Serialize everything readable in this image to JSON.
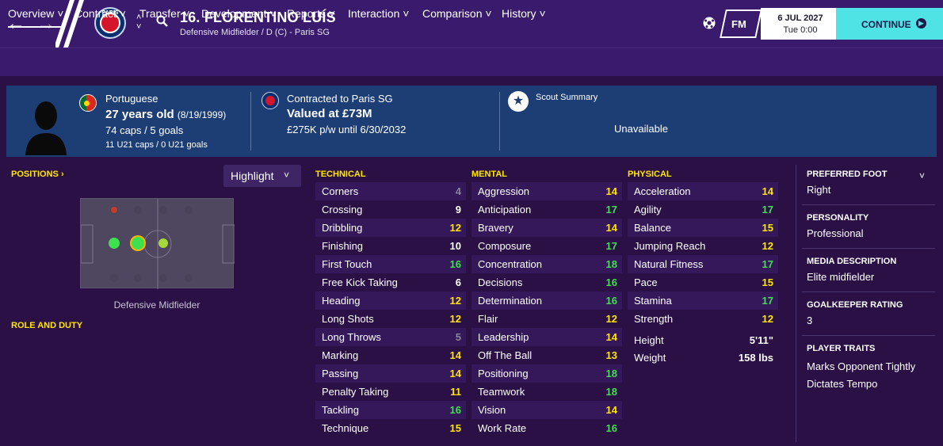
{
  "header": {
    "player_name": "16. FLORENTINO LUÍS",
    "player_subtitle": "Defensive Midfielder / D (C) - Paris SG",
    "club_badge_text": "PARIS",
    "fm_label": "FM",
    "date": "6 JUL 2027",
    "time": "Tue 0:00",
    "continue_label": "CONTINUE"
  },
  "tabs": [
    {
      "label": "Overview"
    },
    {
      "label": "Contract"
    },
    {
      "label": "Transfer"
    },
    {
      "label": "Development"
    },
    {
      "label": "Reports"
    },
    {
      "label": "Interaction"
    },
    {
      "label": "Comparison"
    },
    {
      "label": "History"
    }
  ],
  "info": {
    "nationality": "Portuguese",
    "age_label": "27 years old",
    "dob": "(8/19/1999)",
    "caps": "74 caps / 5 goals",
    "u21_caps": "11 U21 caps / 0 U21 goals",
    "contracted_to": "Contracted to Paris SG",
    "value": "Valued at £73M",
    "wage": "£275K p/w until 6/30/2032",
    "scout_title": "Scout Summary",
    "scout_status": "Unavailable"
  },
  "positions": {
    "title": "POSITIONS",
    "highlight_label": "Highlight",
    "position_label": "Defensive Midfielder",
    "role_duty_title": "ROLE AND DUTY"
  },
  "attributes": {
    "technical_title": "TECHNICAL",
    "mental_title": "MENTAL",
    "physical_title": "PHYSICAL",
    "technical": [
      {
        "name": "Corners",
        "value": "4",
        "tier": "gray"
      },
      {
        "name": "Crossing",
        "value": "9",
        "tier": "white"
      },
      {
        "name": "Dribbling",
        "value": "12",
        "tier": "yellow"
      },
      {
        "name": "Finishing",
        "value": "10",
        "tier": "white"
      },
      {
        "name": "First Touch",
        "value": "16",
        "tier": "green"
      },
      {
        "name": "Free Kick Taking",
        "value": "6",
        "tier": "white"
      },
      {
        "name": "Heading",
        "value": "12",
        "tier": "yellow"
      },
      {
        "name": "Long Shots",
        "value": "12",
        "tier": "yellow"
      },
      {
        "name": "Long Throws",
        "value": "5",
        "tier": "gray"
      },
      {
        "name": "Marking",
        "value": "14",
        "tier": "yellow"
      },
      {
        "name": "Passing",
        "value": "14",
        "tier": "yellow"
      },
      {
        "name": "Penalty Taking",
        "value": "11",
        "tier": "yellow"
      },
      {
        "name": "Tackling",
        "value": "16",
        "tier": "green"
      },
      {
        "name": "Technique",
        "value": "15",
        "tier": "yellow"
      }
    ],
    "mental": [
      {
        "name": "Aggression",
        "value": "14",
        "tier": "yellow"
      },
      {
        "name": "Anticipation",
        "value": "17",
        "tier": "green"
      },
      {
        "name": "Bravery",
        "value": "14",
        "tier": "yellow"
      },
      {
        "name": "Composure",
        "value": "17",
        "tier": "green"
      },
      {
        "name": "Concentration",
        "value": "18",
        "tier": "green"
      },
      {
        "name": "Decisions",
        "value": "16",
        "tier": "green"
      },
      {
        "name": "Determination",
        "value": "16",
        "tier": "green"
      },
      {
        "name": "Flair",
        "value": "12",
        "tier": "yellow"
      },
      {
        "name": "Leadership",
        "value": "14",
        "tier": "yellow"
      },
      {
        "name": "Off The Ball",
        "value": "13",
        "tier": "yellow"
      },
      {
        "name": "Positioning",
        "value": "18",
        "tier": "green"
      },
      {
        "name": "Teamwork",
        "value": "18",
        "tier": "green"
      },
      {
        "name": "Vision",
        "value": "14",
        "tier": "yellow"
      },
      {
        "name": "Work Rate",
        "value": "16",
        "tier": "green"
      }
    ],
    "physical": [
      {
        "name": "Acceleration",
        "value": "14",
        "tier": "yellow"
      },
      {
        "name": "Agility",
        "value": "17",
        "tier": "green"
      },
      {
        "name": "Balance",
        "value": "15",
        "tier": "yellow"
      },
      {
        "name": "Jumping Reach",
        "value": "12",
        "tier": "yellow"
      },
      {
        "name": "Natural Fitness",
        "value": "17",
        "tier": "green"
      },
      {
        "name": "Pace",
        "value": "15",
        "tier": "yellow"
      },
      {
        "name": "Stamina",
        "value": "17",
        "tier": "green"
      },
      {
        "name": "Strength",
        "value": "12",
        "tier": "yellow"
      }
    ],
    "height_label": "Height",
    "height_value": "5'11\"",
    "weight_label": "Weight",
    "weight_value": "158 lbs"
  },
  "side": {
    "preferred_foot_title": "PREFERRED FOOT",
    "preferred_foot": "Right",
    "personality_title": "PERSONALITY",
    "personality": "Professional",
    "media_title": "MEDIA DESCRIPTION",
    "media": "Elite midfielder",
    "gk_title": "GOALKEEPER RATING",
    "gk_rating": "3",
    "traits_title": "PLAYER TRAITS",
    "traits": [
      "Marks Opponent Tightly",
      "Dictates Tempo"
    ]
  },
  "colors": {
    "header_bg": "#3a1a6c",
    "info_bg": "#1d3e74",
    "body_bg": "#2a1045",
    "accent_yellow": "#ffe600",
    "accent_green": "#3fe04f",
    "continue_bg": "#4fe3e6"
  }
}
